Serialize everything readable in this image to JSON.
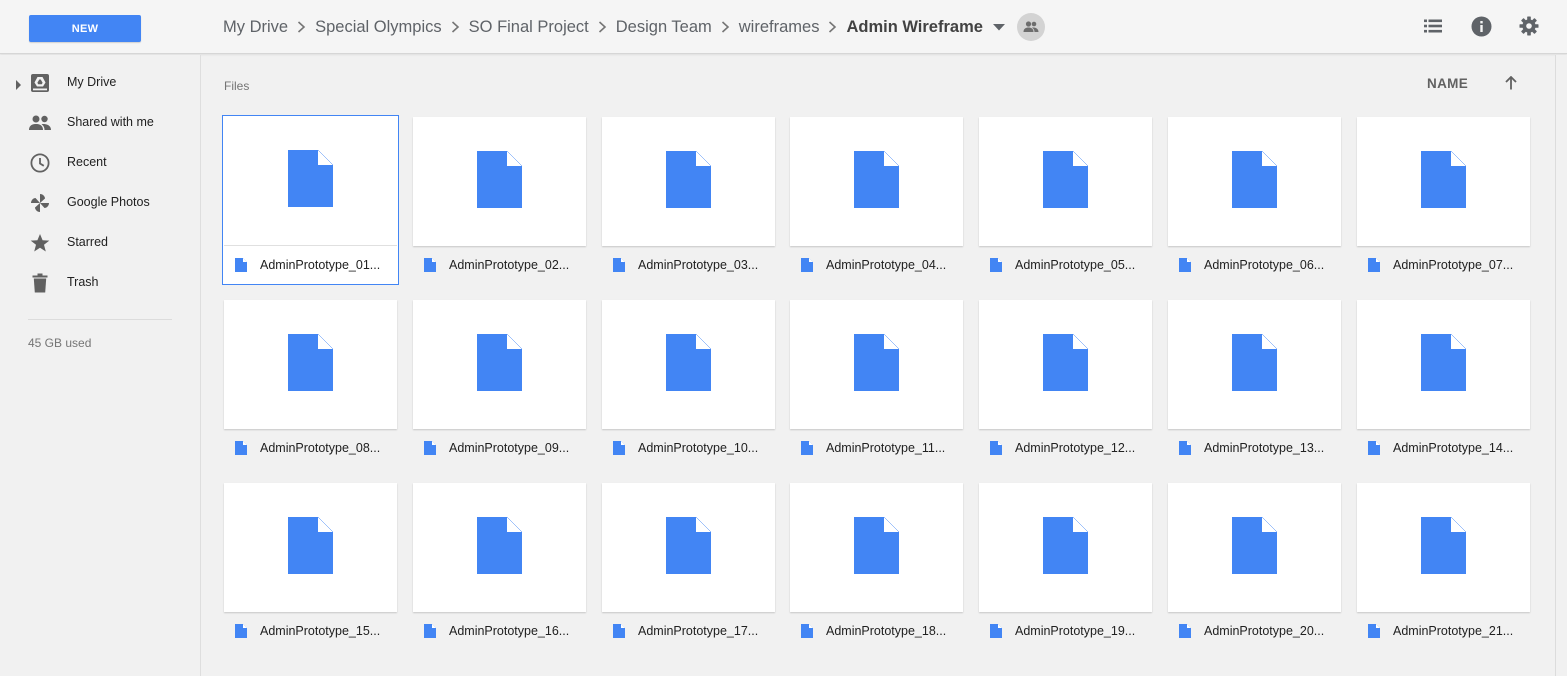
{
  "toolbar": {
    "new_label": "NEW",
    "breadcrumb": [
      "My Drive",
      "Special Olympics",
      "SO Final Project",
      "Design Team",
      "wireframes"
    ],
    "current_folder": "Admin Wireframe",
    "icons": [
      "list-view-icon",
      "info-icon",
      "settings-icon"
    ]
  },
  "sidebar": {
    "items": [
      {
        "label": "My Drive",
        "icon": "drive-icon"
      },
      {
        "label": "Shared with me",
        "icon": "people-icon"
      },
      {
        "label": "Recent",
        "icon": "clock-icon"
      },
      {
        "label": "Google Photos",
        "icon": "pinwheel-icon"
      },
      {
        "label": "Starred",
        "icon": "star-icon"
      },
      {
        "label": "Trash",
        "icon": "trash-icon"
      }
    ],
    "storage_text": "45 GB used"
  },
  "main": {
    "section_label": "Files",
    "sort_label": "NAME",
    "sort_direction": "ascending",
    "selected_index": 0,
    "file_icon_color": "#4285f4",
    "files": [
      "AdminPrototype_01...",
      "AdminPrototype_02...",
      "AdminPrototype_03...",
      "AdminPrototype_04...",
      "AdminPrototype_05...",
      "AdminPrototype_06...",
      "AdminPrototype_07...",
      "AdminPrototype_08...",
      "AdminPrototype_09...",
      "AdminPrototype_10...",
      "AdminPrototype_11...",
      "AdminPrototype_12...",
      "AdminPrototype_13...",
      "AdminPrototype_14...",
      "AdminPrototype_15...",
      "AdminPrototype_16...",
      "AdminPrototype_17...",
      "AdminPrototype_18...",
      "AdminPrototype_19...",
      "AdminPrototype_20...",
      "AdminPrototype_21..."
    ]
  }
}
